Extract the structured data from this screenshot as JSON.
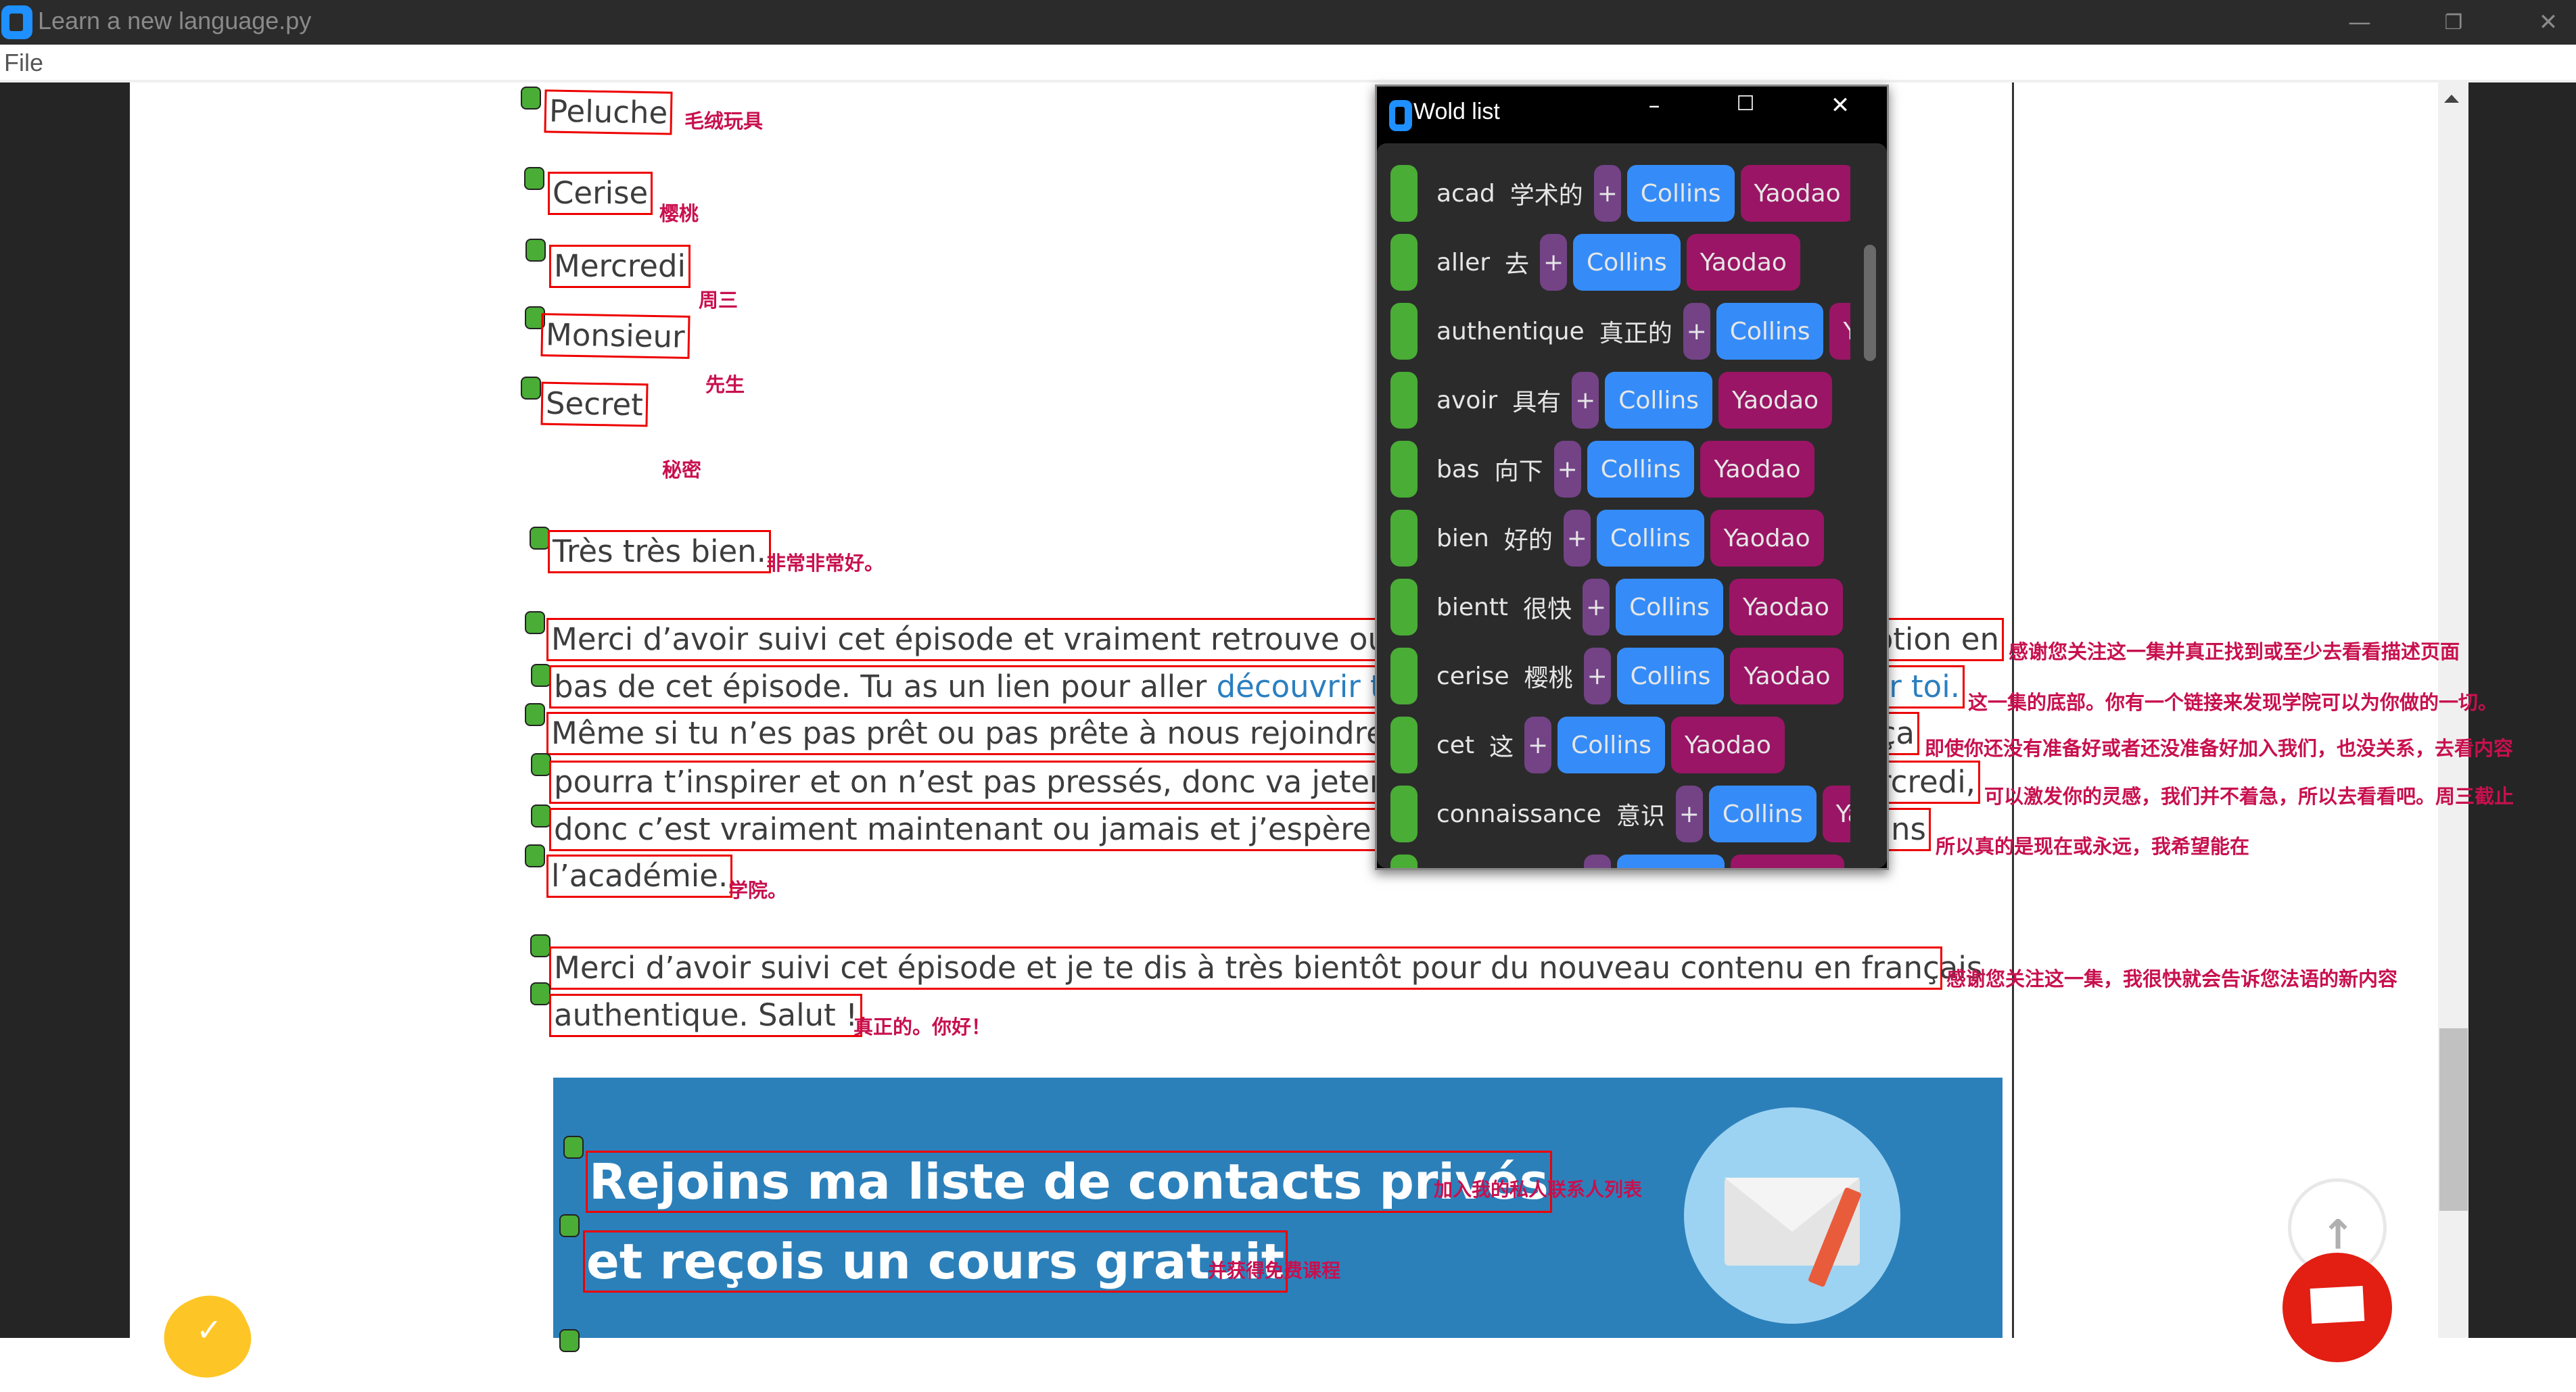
{
  "window": {
    "title": "Learn a new language.py",
    "minimize": "—",
    "restore": "❐",
    "close": "✕"
  },
  "menu": {
    "file": "File"
  },
  "vocab": [
    {
      "fr": "Peluche",
      "zh": "毛绒玩具"
    },
    {
      "fr": "Cerise",
      "zh": "樱桃"
    },
    {
      "fr": "Mercredi",
      "zh": "周三"
    },
    {
      "fr": "Monsieur",
      "zh": "先生"
    },
    {
      "fr": "Secret",
      "zh": "秘密"
    },
    {
      "fr": "Très très bien.",
      "zh": "非常非常好。"
    }
  ],
  "paragraph1": [
    {
      "fr": "Merci d’avoir suivi cet épisode et vraiment retrouve ou",
      "fr_tail": "ption en",
      "zh": "感谢您关注这一集并真正找到或至少去看看描述页面"
    },
    {
      "fr": "bas de cet épisode. Tu as un lien pour aller ",
      "link": "découvrir to",
      "fr_tail": "ur toi.",
      "zh": "这一集的底部。你有一个链接来发现学院可以为你做的一切。"
    },
    {
      "fr": "Même si tu n’es pas prêt ou pas prête à nous rejoindre,",
      "fr_tail": "ça",
      "zh": "即使你还没有准备好或者还没准备好加入我们，也没关系，去看内容"
    },
    {
      "fr": "pourra t’inspirer et on n’est pas pressés, donc va jeter u",
      "fr_tail": "rcredi,",
      "zh": "可以激发你的灵感，我们并不着急，所以去看看吧。周三截止"
    },
    {
      "fr": "donc c’est vraiment maintenant ou jamais et j’espère fa",
      "fr_tail": "ans",
      "zh": "所以真的是现在或永远，我希望能在"
    },
    {
      "fr": "l’académie.",
      "fr_tail": "",
      "zh": "学院。"
    }
  ],
  "paragraph2": [
    {
      "fr": "Merci d’avoir suivi cet épisode et je te dis à très bientôt pour du nouveau contenu en français",
      "zh": "感谢您关注这一集，我很快就会告诉您法语的新内容"
    },
    {
      "fr": "authentique. Salut !",
      "zh": "真正的。你好！"
    }
  ],
  "banner": {
    "line1": "Rejoins ma liste de contacts privés",
    "line1_zh": "加入我的私人联系人列表",
    "line2": "et reçois un cours gratuit",
    "line2_zh": "并获得免费课程"
  },
  "floating": {
    "to_top_icon": "arrow-up-icon",
    "chat_icon": "chat-bubble-icon"
  },
  "word_list": {
    "title": "Wold list",
    "controls": {
      "minimize": "–",
      "maximize": "☐",
      "close": "✕"
    },
    "plus_label": "+",
    "collins_label": "Collins",
    "yaodao_label": "Yaodao",
    "colors": {
      "check": "#4aad36",
      "plus": "#734386",
      "collins": "#358cf8",
      "yaodao": "#9a1565"
    },
    "items": [
      {
        "word": "acad",
        "translation": "学术的"
      },
      {
        "word": "aller",
        "translation": "去"
      },
      {
        "word": "authentique",
        "translation": "真正的"
      },
      {
        "word": "avoir",
        "translation": "具有"
      },
      {
        "word": "bas",
        "translation": "向下"
      },
      {
        "word": "bien",
        "translation": "好的"
      },
      {
        "word": "bientt",
        "translation": "很快"
      },
      {
        "word": "cerise",
        "translation": "樱桃"
      },
      {
        "word": "cet",
        "translation": "这"
      },
      {
        "word": "connaissance",
        "translation": "意识"
      }
    ]
  }
}
